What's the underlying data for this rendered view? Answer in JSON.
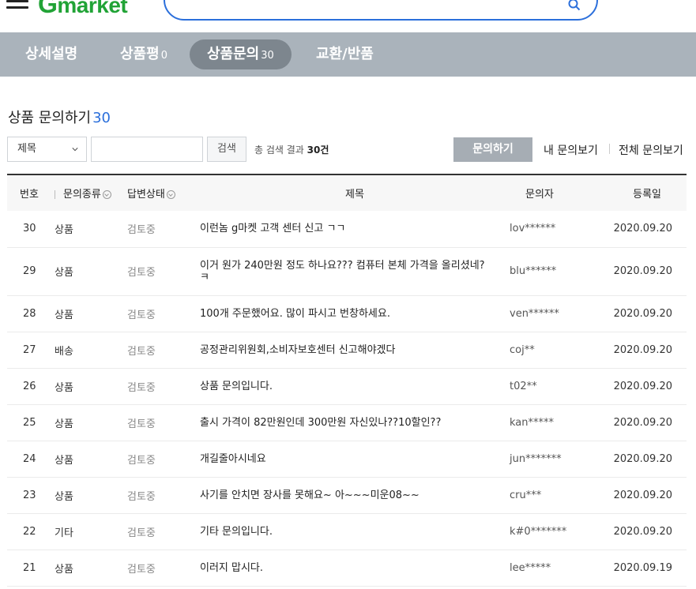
{
  "header": {
    "logo_g": "G",
    "logo_text": "market",
    "search_placeholder": ""
  },
  "tabs": [
    {
      "label": "상세설명",
      "count": ""
    },
    {
      "label": "상품평",
      "count": "0"
    },
    {
      "label": "상품문의",
      "count": "30",
      "active": true
    },
    {
      "label": "교환/반품",
      "count": ""
    }
  ],
  "qa": {
    "title": "상품 문의하기",
    "count": "30",
    "filter": {
      "selected": "제목",
      "search_button": "검색",
      "result_prefix": "총 검색 결과",
      "result_count": "30건"
    },
    "ask_button": "문의하기",
    "my_link": "내 문의보기",
    "all_link": "전체 문의보기",
    "columns": {
      "no": "번호",
      "type": "문의종류",
      "status": "답변상태",
      "title": "제목",
      "user": "문의자",
      "date": "등록일"
    },
    "rows": [
      {
        "no": "30",
        "type": "상품",
        "status": "검토중",
        "title": "이런놈 g마켓 고객 센터 신고 ㄱㄱ",
        "user": "lov******",
        "date": "2020.09.20"
      },
      {
        "no": "29",
        "type": "상품",
        "status": "검토중",
        "title": "이거 원가 240만원 정도 하나요??? 컴퓨터 본체 가격을 올리셨네? ㅋ",
        "user": "blu******",
        "date": "2020.09.20"
      },
      {
        "no": "28",
        "type": "상품",
        "status": "검토중",
        "title": "100개 주문했어요. 많이 파시고 번창하세요.",
        "user": "ven******",
        "date": "2020.09.20"
      },
      {
        "no": "27",
        "type": "배송",
        "status": "검토중",
        "title": "공정관리위원회,소비자보호센터 신고해야겠다",
        "user": "coj**",
        "date": "2020.09.20"
      },
      {
        "no": "26",
        "type": "상품",
        "status": "검토중",
        "title": "상품 문의입니다.",
        "user": "t02**",
        "date": "2020.09.20"
      },
      {
        "no": "25",
        "type": "상품",
        "status": "검토중",
        "title": "출시 가격이 82만원인데 300만원 자신있나??10할인??",
        "user": "kan*****",
        "date": "2020.09.20"
      },
      {
        "no": "24",
        "type": "상품",
        "status": "검토중",
        "title": "개길줄아시네요",
        "user": "jun*******",
        "date": "2020.09.20"
      },
      {
        "no": "23",
        "type": "상품",
        "status": "검토중",
        "title": "사기를 안치면 장사를 못해요~ 아~~~미운08~~",
        "user": "cru***",
        "date": "2020.09.20"
      },
      {
        "no": "22",
        "type": "기타",
        "status": "검토중",
        "title": "기타 문의입니다.",
        "user": "k#0*******",
        "date": "2020.09.20"
      },
      {
        "no": "21",
        "type": "상품",
        "status": "검토중",
        "title": "이러지 맙시다.",
        "user": "lee*****",
        "date": "2020.09.19"
      }
    ]
  }
}
